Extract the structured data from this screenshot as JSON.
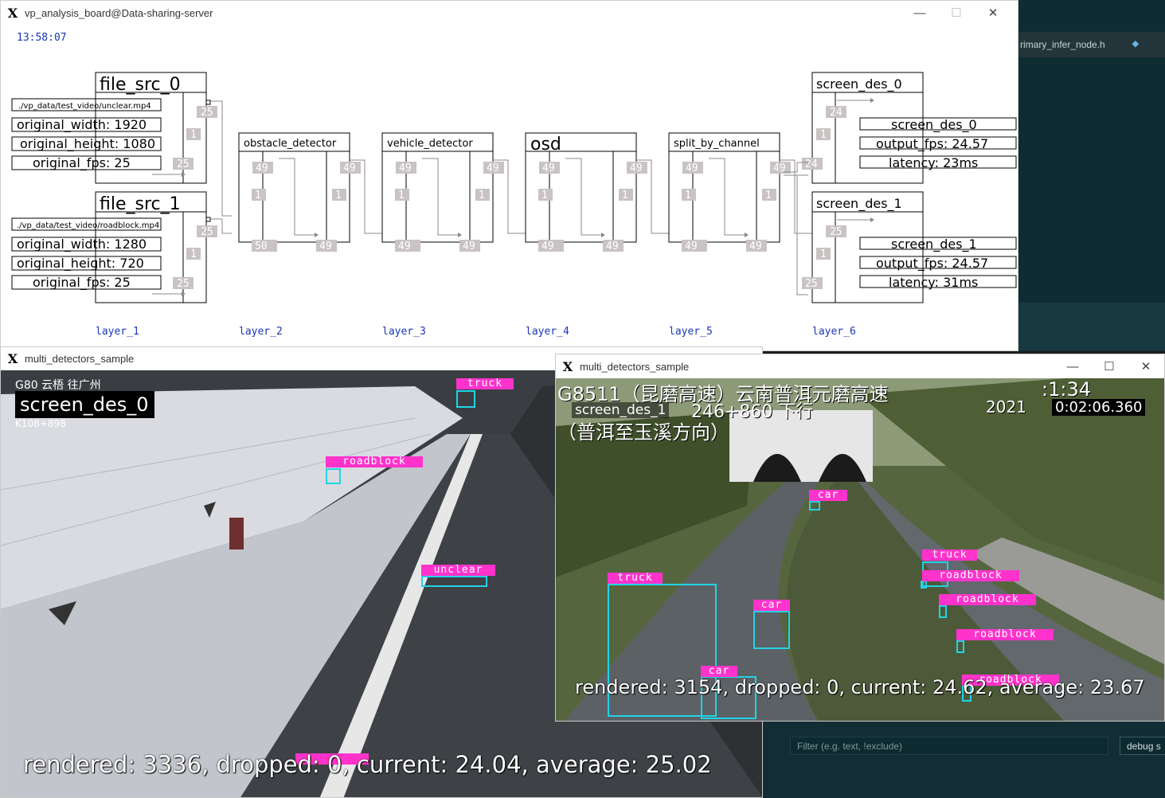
{
  "board": {
    "title": "vp_analysis_board@Data-sharing-server",
    "clock": "13:58:07",
    "controls": {
      "minimize": "—",
      "maximize": "☐",
      "close": "✕"
    },
    "layers": [
      "layer_1",
      "layer_2",
      "layer_3",
      "layer_4",
      "layer_5",
      "layer_6"
    ],
    "src0": {
      "name": "file_src_0",
      "path": "./vp_data/test_video/unclear.mp4",
      "width": "original_width: 1920",
      "height": "original_height: 1080",
      "fps": "original_fps: 25",
      "q_top": "25",
      "q_mid": "1",
      "q_bot": "25"
    },
    "src1": {
      "name": "file_src_1",
      "path": "./vp_data/test_video/roadblock.mp4",
      "width": "original_width: 1280",
      "height": "original_height: 720",
      "fps": "original_fps: 25",
      "q_top": "25",
      "q_mid": "1",
      "q_bot": "25"
    },
    "mid_nodes": [
      {
        "name": "obstacle_detector",
        "in": "50",
        "a": "49",
        "b": "49",
        "c": "1",
        "d": "1",
        "e": "49"
      },
      {
        "name": "vehicle_detector",
        "in": "49",
        "a": "49",
        "b": "49",
        "c": "1",
        "d": "1",
        "e": "49"
      },
      {
        "name": "osd",
        "in": "49",
        "a": "49",
        "b": "49",
        "c": "1",
        "d": "1",
        "e": "49"
      },
      {
        "name": "split_by_channel",
        "in": "49",
        "a": "49",
        "b": "49",
        "c": "1",
        "d": "1",
        "e": "49"
      }
    ],
    "des0": {
      "name": "screen_des_0",
      "q_top": "24",
      "q_mid": "1",
      "q_bot": "24",
      "label": "screen_des_0",
      "fps": "output_fps: 24.57",
      "latency": "latency: 23ms"
    },
    "des1": {
      "name": "screen_des_1",
      "q_top": "25",
      "q_mid": "1",
      "q_bot": "25",
      "label": "screen_des_1",
      "fps": "output_fps: 24.57",
      "latency": "latency: 31ms"
    }
  },
  "editor": {
    "tab1": "rimary_infer_node.h",
    "tab2_icon": "⯁",
    "tab2": "",
    "filter_placeholder": "Filter (e.g. text, !exclude)",
    "debug_btn": "debug s"
  },
  "win1": {
    "title": "multi_detectors_sample",
    "overlay_top": "G80 云梧 往广州",
    "overlay_label": "screen_des_0",
    "overlay_km": "K108+898",
    "stats": "rendered: 3336, dropped: 0, current: 24.04, average: 25.02",
    "detections": [
      {
        "label": "truck"
      },
      {
        "label": "roadblock"
      },
      {
        "label": "unclear"
      }
    ]
  },
  "win2": {
    "title": "multi_detectors_sample",
    "controls": {
      "minimize": "—",
      "maximize": "☐",
      "close": "✕"
    },
    "overlay_line1": "G8511（昆磨高速）云南普洱元磨高速",
    "overlay_time": ":1:34",
    "overlay_line2": "screen_des_1",
    "overlay_line2b": "246+860 下行",
    "overlay_line3": "（普洱至玉溪方向）",
    "overlay_year": "2021",
    "overlay_clock": "0:02:06.360",
    "stats": "rendered: 3154, dropped: 0, current: 24.62, average: 23.67",
    "detections": [
      {
        "label": "car"
      },
      {
        "label": "truck"
      },
      {
        "label": "truck"
      },
      {
        "label": "roadblock"
      },
      {
        "label": "car"
      },
      {
        "label": "roadblock"
      },
      {
        "label": "roadblock"
      },
      {
        "label": "car"
      },
      {
        "label": "roadblock"
      }
    ]
  }
}
